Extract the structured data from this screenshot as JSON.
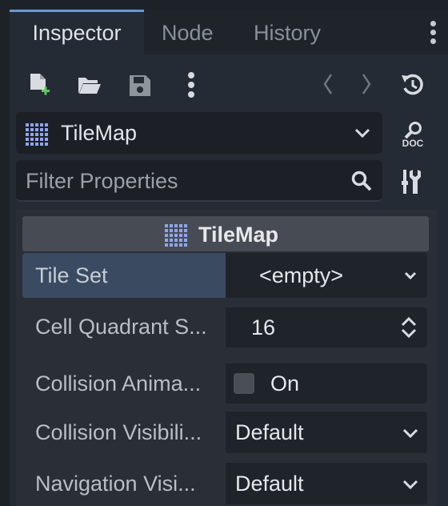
{
  "tabs": [
    {
      "label": "Inspector",
      "active": true
    },
    {
      "label": "Node",
      "active": false
    },
    {
      "label": "History",
      "active": false
    }
  ],
  "toolbar": {
    "icons": [
      "new-resource-icon",
      "open-folder-icon",
      "save-icon",
      "more-vertical-icon",
      "back-arrow-icon",
      "forward-arrow-icon",
      "history-icon"
    ]
  },
  "object": {
    "class_name": "TileMap",
    "doc_label": "DOC"
  },
  "filter": {
    "placeholder": "Filter Properties"
  },
  "section": {
    "title": "TileMap"
  },
  "properties": [
    {
      "label": "Tile Set",
      "value": "<empty>",
      "control": "dropdown"
    },
    {
      "label": "Cell Quadrant S...",
      "value": "16",
      "control": "spinbox"
    },
    {
      "label": "Collision Anima...",
      "value": "On",
      "control": "checkbox",
      "checked": false
    },
    {
      "label": "Collision Visibili...",
      "value": "Default",
      "control": "dropdown"
    },
    {
      "label": "Navigation Visi...",
      "value": "Default",
      "control": "dropdown"
    }
  ],
  "colors": {
    "accent": "#6a9ad3",
    "tilemap_icon": "#8fa6ec",
    "new_icon_plus": "#5fc95f",
    "highlight_row": "#3a4a61"
  }
}
